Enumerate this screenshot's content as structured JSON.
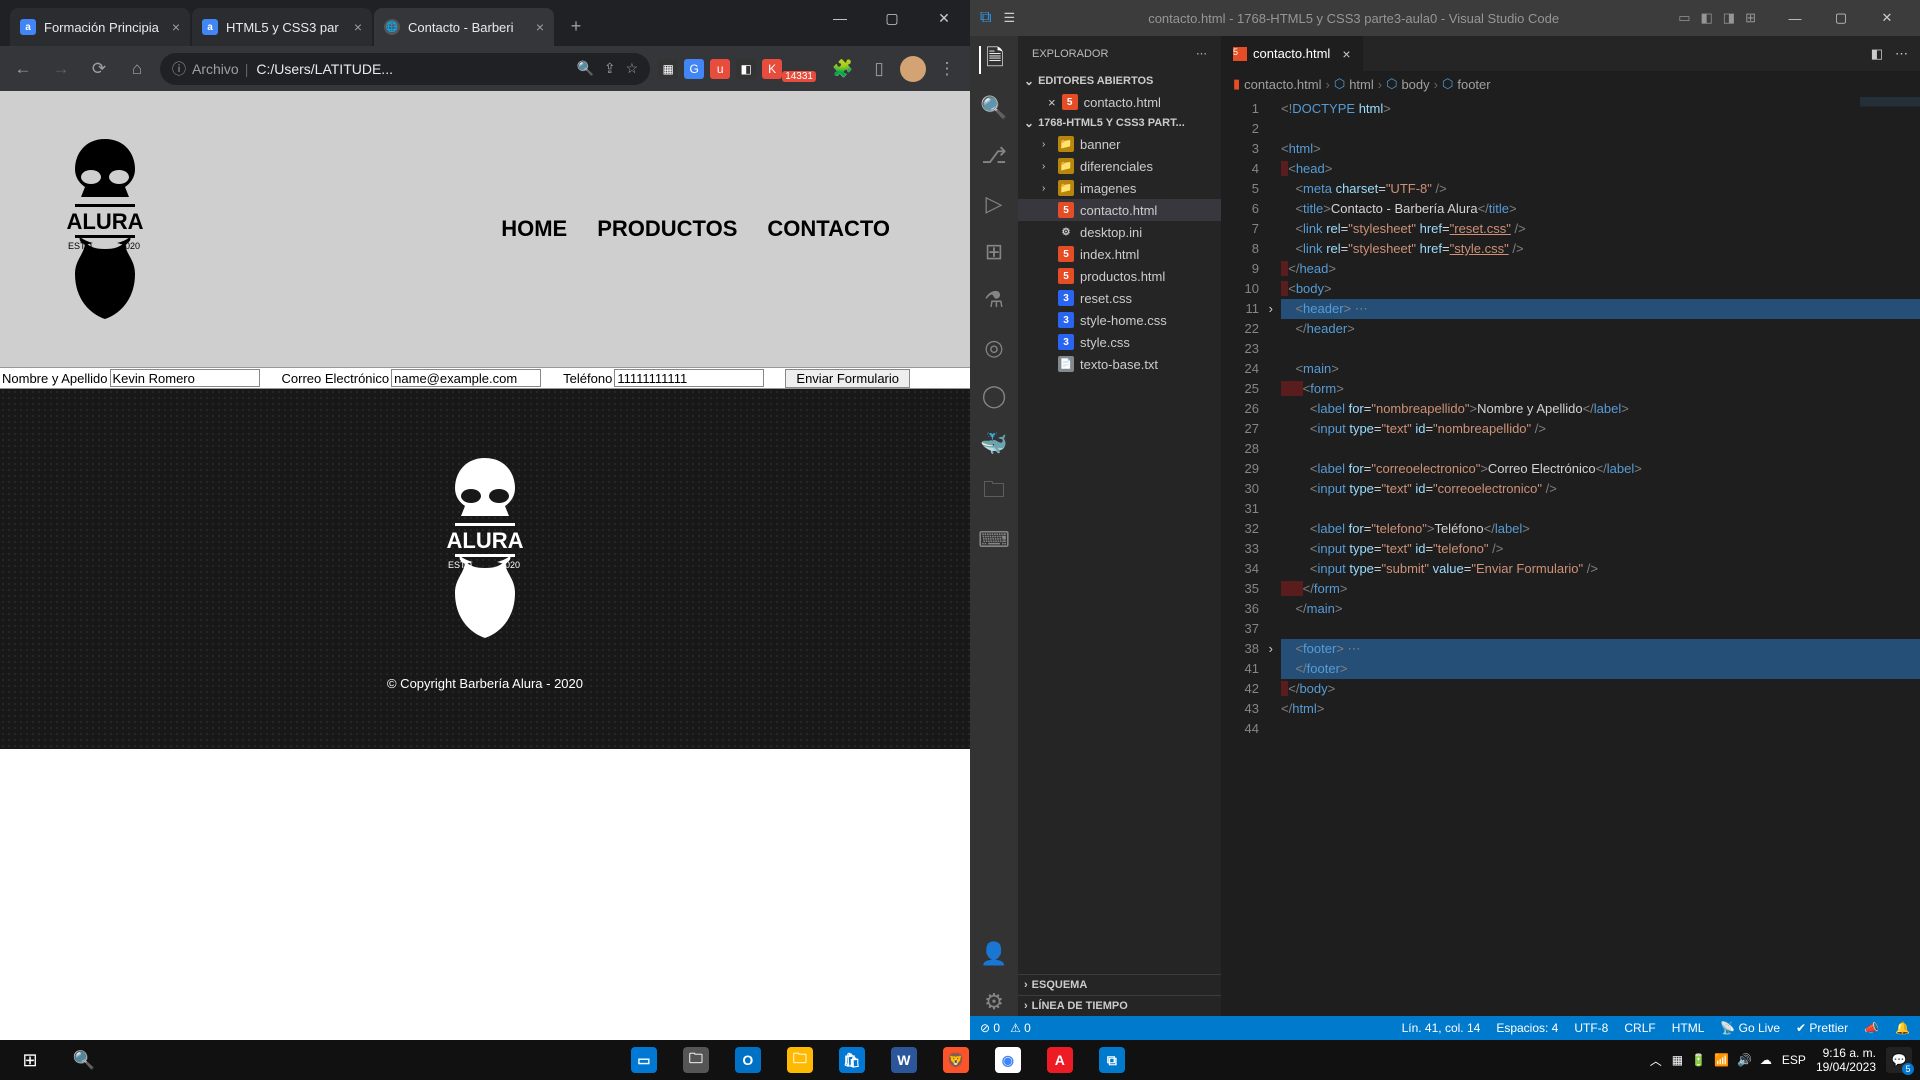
{
  "browser": {
    "tabs": [
      {
        "title": "Formación Principia",
        "favicon": "a"
      },
      {
        "title": "HTML5 y CSS3 par",
        "favicon": "a"
      },
      {
        "title": "Contacto - Barberi",
        "favicon": "globe",
        "active": true
      }
    ],
    "address_prefix": "Archivo",
    "address": "C:/Users/LATITUDE...",
    "ext_badge": "14331"
  },
  "page": {
    "logo_text": "ALURA",
    "logo_est_left": "ESTD",
    "logo_est_right": "2020",
    "nav": [
      "HOME",
      "PRODUCTOS",
      "CONTACTO"
    ],
    "form": {
      "name_label": "Nombre y Apellido",
      "name_value": "Kevin Romero",
      "email_label": "Correo Electrónico",
      "email_value": "name@example.com",
      "tel_label": "Teléfono",
      "tel_value": "11111111111",
      "submit": "Enviar Formulario"
    },
    "copyright": "© Copyright Barbería Alura - 2020"
  },
  "vscode": {
    "title": "contacto.html - 1768-HTML5 y CSS3 parte3-aula0 - Visual Studio Code",
    "explorer_title": "EXPLORADOR",
    "open_editors": "EDITORES ABIERTOS",
    "open_editor_file": "contacto.html",
    "project": "1768-HTML5 Y CSS3 PART...",
    "tree": {
      "folders": [
        "banner",
        "diferenciales",
        "imagenes"
      ],
      "files": [
        {
          "name": "contacto.html",
          "type": "html5",
          "active": true
        },
        {
          "name": "desktop.ini",
          "type": "gear"
        },
        {
          "name": "index.html",
          "type": "html5"
        },
        {
          "name": "productos.html",
          "type": "html5"
        },
        {
          "name": "reset.css",
          "type": "css3"
        },
        {
          "name": "style-home.css",
          "type": "css3"
        },
        {
          "name": "style.css",
          "type": "css3"
        },
        {
          "name": "texto-base.txt",
          "type": "txt"
        }
      ]
    },
    "outline": "ESQUEMA",
    "timeline": "LÍNEA DE TIEMPO",
    "tab_file": "contacto.html",
    "breadcrumb": [
      "contacto.html",
      "html",
      "body",
      "footer"
    ],
    "line_numbers": [
      "1",
      "2",
      "3",
      "4",
      "5",
      "6",
      "7",
      "8",
      "9",
      "10",
      "11",
      "22",
      "23",
      "24",
      "25",
      "26",
      "27",
      "28",
      "29",
      "30",
      "31",
      "32",
      "33",
      "34",
      "35",
      "36",
      "37",
      "38",
      "41",
      "42",
      "43",
      "44"
    ],
    "fold_lines": [
      "11",
      "38"
    ],
    "code": {
      "l1": "<!DOCTYPE html>",
      "l3_o": "<html>",
      "l4_o": "<head>",
      "l5": "<meta charset=\"UTF-8\" />",
      "l6_title": "Contacto - Barbería Alura",
      "l7_href": "reset.css",
      "l8_href": "style.css",
      "l9_c": "</head>",
      "l10_o": "<body>",
      "l11_o": "<header>",
      "l22_c": "</header>",
      "l24_o": "<main>",
      "l25_o": "<form>",
      "l26_for": "nombreapellido",
      "l26_txt": "Nombre y Apellido",
      "l27_id": "nombreapellido",
      "l29_for": "correoelectronico",
      "l29_txt": "Correo Electrónico",
      "l30_id": "correoelectronico",
      "l32_for": "telefono",
      "l32_txt": "Teléfono",
      "l33_id": "telefono",
      "l34_val": "Enviar Formulario",
      "l35_c": "</form>",
      "l36_c": "</main>",
      "l38_o": "<footer>",
      "l41_c": "</footer>",
      "l42_c": "</body>",
      "l43_c": "</html>"
    },
    "status": {
      "errors": "⊘ 0",
      "warnings": "⚠ 0",
      "position": "Lín. 41, col. 14",
      "spaces": "Espacios: 4",
      "encoding": "UTF-8",
      "eol": "CRLF",
      "lang": "HTML",
      "golive": "Go Live",
      "prettier": "✔ Prettier"
    }
  },
  "taskbar": {
    "lang": "ESP",
    "time": "9:16 a. m.",
    "date": "19/04/2023",
    "notif_count": "5"
  }
}
